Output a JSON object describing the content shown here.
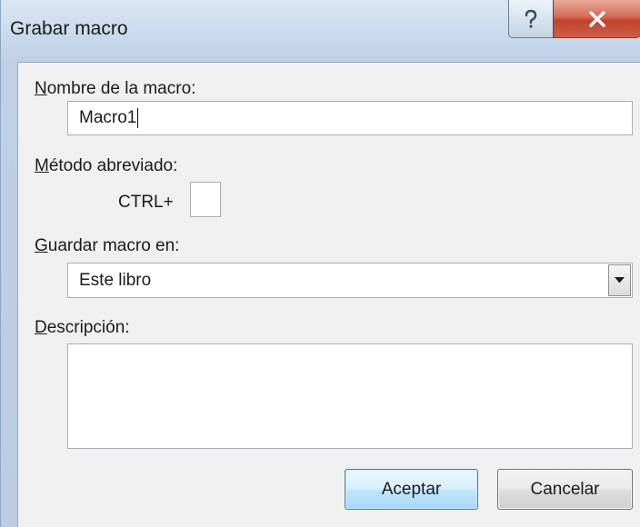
{
  "dialog": {
    "title": "Grabar macro",
    "title_buttons": {
      "help_icon": "question-mark-icon",
      "close_icon": "close-x-icon"
    }
  },
  "macro_name": {
    "label_accel": "N",
    "label_rest": "ombre de la macro:",
    "value": "Macro1"
  },
  "shortcut": {
    "label_accel": "M",
    "label_rest": "étodo abreviado:",
    "prefix": "CTRL+",
    "value": ""
  },
  "store_in": {
    "label_accel": "G",
    "label_rest": "uardar macro en:",
    "selected": "Este libro",
    "dropdown_icon": "chevron-down-icon"
  },
  "description": {
    "label_accel": "D",
    "label_rest": "escripción:",
    "value": ""
  },
  "buttons": {
    "ok": "Aceptar",
    "cancel": "Cancelar"
  },
  "colors": {
    "title_bar": "#c9d9ec",
    "client_bg": "#f0f0f0",
    "close_button": "#c1432c",
    "default_button_border": "#3c7fb1"
  }
}
